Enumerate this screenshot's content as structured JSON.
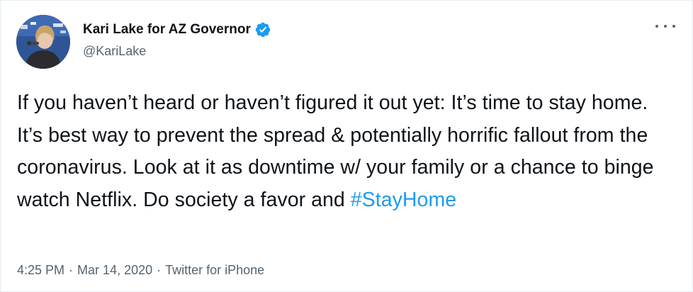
{
  "author": {
    "display_name": "Kari Lake for AZ Governor",
    "handle": "@KariLake",
    "verified": true,
    "verified_color": "#1d9bf0"
  },
  "tweet": {
    "text_main": "If you haven’t heard or haven’t figured it out yet: It’s time to stay home. It’s best way to prevent the spread & potentially horrific fallout from the coronavirus. Look at it as downtime w/ your family or a chance to binge watch Netflix. Do society a favor and ",
    "hashtag": "#StayHome",
    "hashtag_color": "#1d9bf0"
  },
  "meta": {
    "time": "4:25 PM",
    "separator": "·",
    "date": "Mar 14, 2020",
    "source": "Twitter for iPhone"
  },
  "icons": {
    "avatar": "profile-photo",
    "verified": "verified-badge-icon",
    "more": "more-options-icon"
  }
}
